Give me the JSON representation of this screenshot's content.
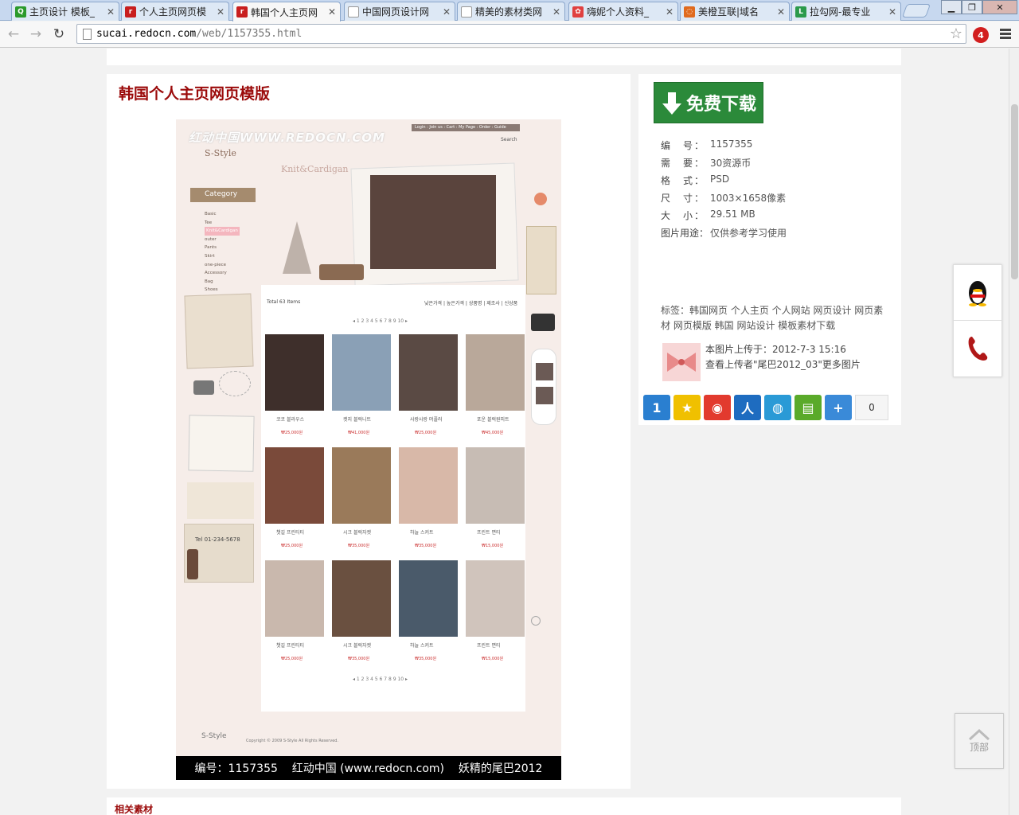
{
  "browser": {
    "tabs": [
      {
        "title": "主页设计 模板_",
        "icon_color": "#2b9a2b",
        "icon_glyph": "Q"
      },
      {
        "title": "个人主页网页模",
        "icon_color": "#c81e1e",
        "icon_glyph": "r"
      },
      {
        "title": "韩国个人主页网",
        "icon_color": "#c81e1e",
        "icon_glyph": "r"
      },
      {
        "title": "中国网页设计网",
        "icon_color": "#ffffff",
        "icon_glyph": ""
      },
      {
        "title": "精美的素材类网",
        "icon_color": "#ffffff",
        "icon_glyph": ""
      },
      {
        "title": "嗨妮个人资料_",
        "icon_color": "#e04040",
        "icon_glyph": "✿"
      },
      {
        "title": "美橙互联|域名",
        "icon_color": "#e06a1e",
        "icon_glyph": "◌"
      },
      {
        "title": "拉勾网-最专业",
        "icon_color": "#2b9a4b",
        "icon_glyph": "L"
      }
    ],
    "active_tab_index": 2,
    "url_host": "sucai.redocn.com",
    "url_path": "/web/1157355.html",
    "ext_badge": "4"
  },
  "page": {
    "title": "韩国个人主页网页模版",
    "caption": "编号：1157355    红动中国 (www.redocn.com)    妖精的尾巴2012",
    "related_heading": "相关素材"
  },
  "preview": {
    "watermark": "红动中国WWW.REDOCN.COM",
    "logo": "S-Style",
    "top_links": "Login : Join us : Cart : My Page : Order : Guide",
    "search_label": "Search",
    "heading": "Knit&Cardigan",
    "category_title": "Category",
    "categories": [
      "Basic",
      "Tee",
      "Knit&Cardigan",
      "outer",
      "Pants",
      "Skirt",
      "one-piece",
      "Accessory",
      "Bag",
      "Shoes"
    ],
    "total_label": "Total 63 Items",
    "sort_links": "낮은가격 | 높은가격 | 상품명 | 제조사 | 신상품",
    "pagination": "◂ 1 2 3 4 5 6 7 8 9 10 ▸",
    "phone": "Tel 01-234-5678",
    "products": [
      {
        "name": "코코 블라우스",
        "price": "₩25,000원"
      },
      {
        "name": "켓지 블럭니트",
        "price": "₩41,000원"
      },
      {
        "name": "사랑사랑 머플러",
        "price": "₩25,000원"
      },
      {
        "name": "포운 블럭원피트",
        "price": "₩45,000원"
      },
      {
        "name": "챗길 프린티티",
        "price": "₩25,000원"
      },
      {
        "name": "시크 블럭자켓",
        "price": "₩35,000원"
      },
      {
        "name": "하늘 스커트",
        "price": "₩35,000원"
      },
      {
        "name": "프린트 면티",
        "price": "₩15,000원"
      },
      {
        "name": "챗길 프린티티",
        "price": "₩25,000원"
      },
      {
        "name": "시크 블럭자켓",
        "price": "₩35,000원"
      },
      {
        "name": "하늘 스커트",
        "price": "₩35,000원"
      },
      {
        "name": "프린트 면티",
        "price": "₩15,000원"
      }
    ],
    "footer_text": "Copyright © 2009 S-Style All Rights Reserved."
  },
  "sidebar": {
    "download_label": "免费下载",
    "info": [
      {
        "key": "编　号：",
        "value": "1157355"
      },
      {
        "key": "需　要：",
        "value": "30资源币"
      },
      {
        "key": "格　式：",
        "value": "PSD"
      },
      {
        "key": "尺　寸：",
        "value": "1003×1658像素"
      },
      {
        "key": "大　小：",
        "value": "29.51 MB"
      },
      {
        "key": "图片用途：",
        "value": "仅供参考学习使用"
      }
    ],
    "tags": "标签：韩国网页 个人主页 个人网站 网页设计 网页素材 网页模版 韩国 网站设计 模板素材下载",
    "upload_time": "本图片上传于：2012-7-3 15:16",
    "uploader_link": "查看上传者\"尾巴2012_03\"更多图片",
    "share_count": "0",
    "share_icons": [
      {
        "name": "share-1-icon",
        "color": "#2a7fd0",
        "glyph": "1"
      },
      {
        "name": "share-qzone-icon",
        "color": "#f0c000",
        "glyph": "★"
      },
      {
        "name": "share-weibo-icon",
        "color": "#e23a2e",
        "glyph": "◉"
      },
      {
        "name": "share-renren-icon",
        "color": "#1e6cc0",
        "glyph": "人"
      },
      {
        "name": "share-tqq-icon",
        "color": "#2a9ad6",
        "glyph": "◍"
      },
      {
        "name": "share-kaixin-icon",
        "color": "#5aaa2a",
        "glyph": "▤"
      },
      {
        "name": "share-more-icon",
        "color": "#3a8ad8",
        "glyph": "+"
      }
    ]
  },
  "float": {
    "top_label": "顶部"
  },
  "colors": {
    "title_red": "#9b0a0a",
    "download_green": "#2b8a3a"
  }
}
